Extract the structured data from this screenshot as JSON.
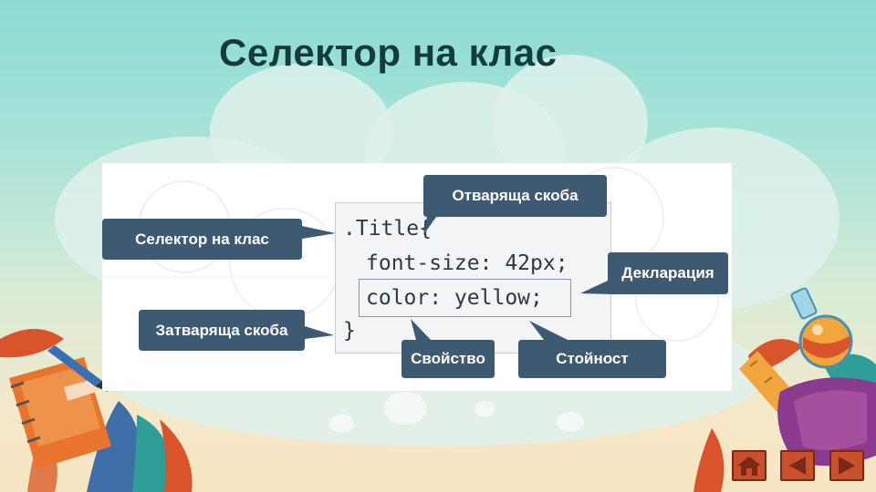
{
  "slide": {
    "title": "Селектор на клас"
  },
  "diagram": {
    "code_lines": [
      ".Title{",
      "font-size: 42px;",
      "color: yellow;",
      "}"
    ],
    "callouts": {
      "opening_brace": "Отваряща скоба",
      "class_selector": "Селектор на клас",
      "declaration": "Декларация",
      "closing_brace": "Затваряща скоба",
      "property": "Свойство",
      "value": "Стойност"
    }
  },
  "navigation": {
    "home_icon": "home-icon",
    "prev_icon": "arrow-left-icon",
    "next_icon": "arrow-right-icon"
  },
  "colors": {
    "callout_fill": "#3d5a72",
    "title": "#123d3b",
    "nav_button": "#c9502b"
  }
}
